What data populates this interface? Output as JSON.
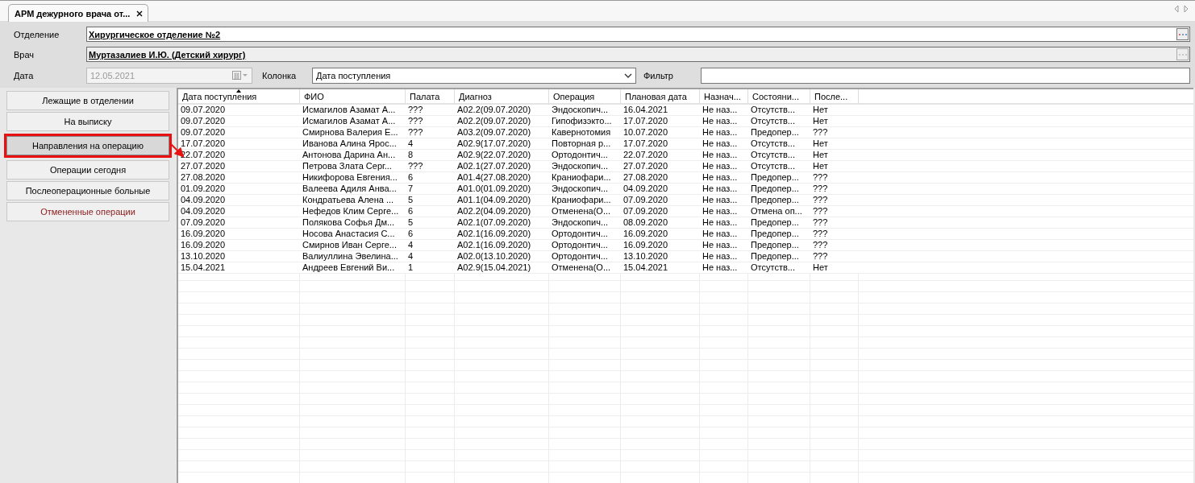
{
  "tabs": [
    {
      "label": "АРМ дежурного врача от...",
      "selected": true
    }
  ],
  "form": {
    "department": {
      "label": "Отделение",
      "value": "Хирургическое отделение №2",
      "disabled": false
    },
    "doctor": {
      "label": "Врач",
      "value": "Муртазалиев И.Ю. (Детский хирург)",
      "disabled": true
    },
    "date": {
      "label": "Дата",
      "value": "12.05.2021",
      "disabled": true
    },
    "column": {
      "label": "Колонка",
      "value": "Дата поступления"
    },
    "filter": {
      "label": "Фильтр"
    }
  },
  "nav": [
    {
      "label": "Лежащие в отделении",
      "selected": false,
      "highlighted": false,
      "kind": "normal"
    },
    {
      "label": "На выписку",
      "selected": false,
      "highlighted": false,
      "kind": "normal"
    },
    {
      "label": "Направления на операцию",
      "selected": true,
      "highlighted": true,
      "kind": "normal"
    },
    {
      "label": "Операции сегодня",
      "selected": false,
      "highlighted": false,
      "kind": "normal"
    },
    {
      "label": "Послеоперационные больные",
      "selected": false,
      "highlighted": false,
      "kind": "normal"
    },
    {
      "label": "Отмененные операции",
      "selected": false,
      "highlighted": false,
      "kind": "cancelled"
    }
  ],
  "table": {
    "columns": [
      {
        "label": "Дата поступления",
        "sorted": true
      },
      {
        "label": "ФИО",
        "sorted": false
      },
      {
        "label": "Палата",
        "sorted": false
      },
      {
        "label": "Диагноз",
        "sorted": false
      },
      {
        "label": "Операция",
        "sorted": false
      },
      {
        "label": "Плановая дата",
        "sorted": false
      },
      {
        "label": "Назнач...",
        "sorted": false
      },
      {
        "label": "Состояни...",
        "sorted": false
      },
      {
        "label": "После...",
        "sorted": false
      }
    ],
    "rows": [
      [
        "09.07.2020",
        "Исмагилов Азамат А...",
        "???",
        "A02.2(09.07.2020)",
        "Эндоскопич...",
        "16.04.2021",
        "Не наз...",
        "Отсутств...",
        "Нет"
      ],
      [
        "09.07.2020",
        "Исмагилов Азамат А...",
        "???",
        "A02.2(09.07.2020)",
        "Гипофизэкто...",
        "17.07.2020",
        "Не наз...",
        "Отсутств...",
        "Нет"
      ],
      [
        "09.07.2020",
        "Смирнова Валерия Е...",
        "???",
        "A03.2(09.07.2020)",
        "Кавернотомия",
        "10.07.2020",
        "Не наз...",
        "Предопер...",
        "???"
      ],
      [
        "17.07.2020",
        "Иванова Алина Ярос...",
        "4",
        "A02.9(17.07.2020)",
        "Повторная р...",
        "17.07.2020",
        "Не наз...",
        "Отсутств...",
        "Нет"
      ],
      [
        "22.07.2020",
        "Антонова Дарина Ан...",
        "8",
        "A02.9(22.07.2020)",
        "Ортодонтич...",
        "22.07.2020",
        "Не наз...",
        "Отсутств...",
        "Нет"
      ],
      [
        "27.07.2020",
        "Петрова Злата Серг...",
        "???",
        "A02.1(27.07.2020)",
        "Эндоскопич...",
        "27.07.2020",
        "Не наз...",
        "Отсутств...",
        "Нет"
      ],
      [
        "27.08.2020",
        "Никифорова Евгения...",
        "6",
        "A01.4(27.08.2020)",
        "Краниофари...",
        "27.08.2020",
        "Не наз...",
        "Предопер...",
        "???"
      ],
      [
        "01.09.2020",
        "Валеева Адиля Анва...",
        "7",
        "A01.0(01.09.2020)",
        "Эндоскопич...",
        "04.09.2020",
        "Не наз...",
        "Предопер...",
        "???"
      ],
      [
        "04.09.2020",
        "Кондратьева Алена ...",
        "5",
        "A01.1(04.09.2020)",
        "Краниофари...",
        "07.09.2020",
        "Не наз...",
        "Предопер...",
        "???"
      ],
      [
        "04.09.2020",
        "Нефедов Клим Серге...",
        "6",
        "A02.2(04.09.2020)",
        "Отменена(О...",
        "07.09.2020",
        "Не наз...",
        "Отмена оп...",
        "???"
      ],
      [
        "07.09.2020",
        "Полякова Софья Дм...",
        "5",
        "A02.1(07.09.2020)",
        "Эндоскопич...",
        "08.09.2020",
        "Не наз...",
        "Предопер...",
        "???"
      ],
      [
        "16.09.2020",
        "Носова Анастасия С...",
        "6",
        "A02.1(16.09.2020)",
        "Ортодонтич...",
        "16.09.2020",
        "Не наз...",
        "Предопер...",
        "???"
      ],
      [
        "16.09.2020",
        "Смирнов Иван Серге...",
        "4",
        "A02.1(16.09.2020)",
        "Ортодонтич...",
        "16.09.2020",
        "Не наз...",
        "Предопер...",
        "???"
      ],
      [
        "13.10.2020",
        "Валиуллина Эвелина...",
        "4",
        "A02.0(13.10.2020)",
        "Ортодонтич...",
        "13.10.2020",
        "Не наз...",
        "Предопер...",
        "???"
      ],
      [
        "15.04.2021",
        "Андреев Евгений Ви...",
        "1",
        "A02.9(15.04.2021)",
        "Отменена(О...",
        "15.04.2021",
        "Не наз...",
        "Отсутств...",
        "Нет"
      ]
    ]
  }
}
